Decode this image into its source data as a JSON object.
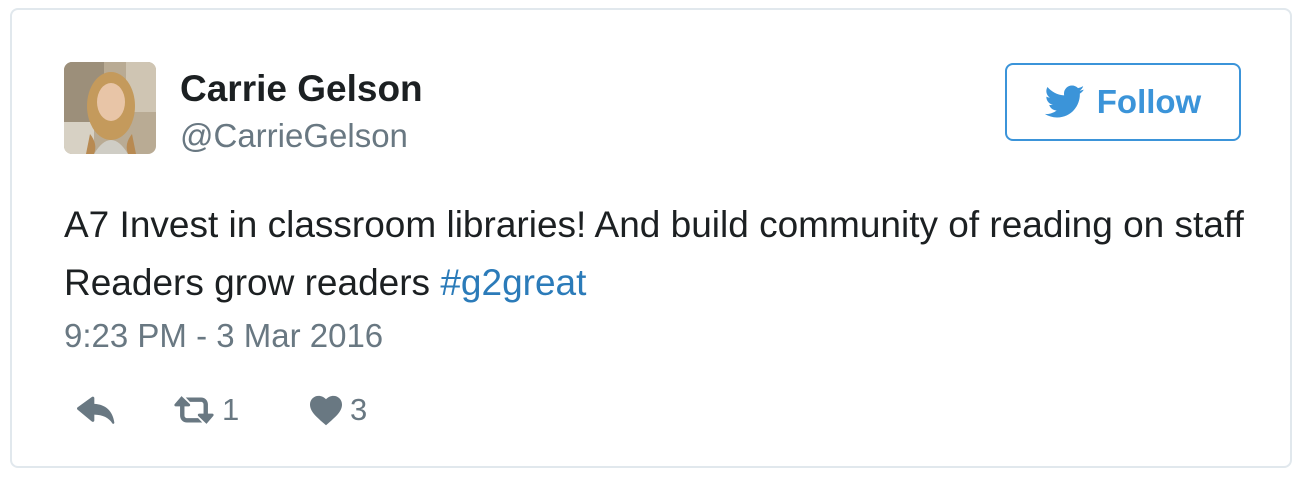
{
  "tweet": {
    "author": {
      "display_name": "Carrie Gelson",
      "handle": "@CarrieGelson"
    },
    "follow_button": {
      "label": "Follow",
      "icon": "twitter-bird-icon"
    },
    "text_before_hashtag": "A7 Invest in classroom libraries! And build community of reading on staff Readers grow readers ",
    "hashtag": "#g2great",
    "timestamp": "9:23 PM - 3 Mar 2016",
    "actions": {
      "reply_icon": "reply-icon",
      "retweet_icon": "retweet-icon",
      "retweet_count": "1",
      "like_icon": "heart-icon",
      "like_count": "3"
    },
    "colors": {
      "accent": "#3b94d9",
      "link": "#2b7bb9",
      "secondary_text": "#697882",
      "primary_text": "#1c2022",
      "border": "#e1e8ed"
    }
  }
}
